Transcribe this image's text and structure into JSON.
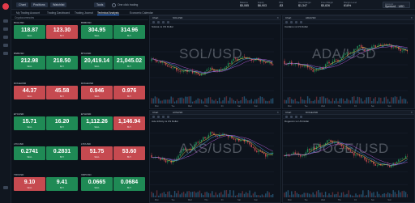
{
  "topbar": {
    "buttons": [
      "Chart",
      "Positions",
      "Watchlist",
      "Tools"
    ],
    "one_click_label": "One click trading",
    "account": [
      {
        "k": "Balance",
        "v": "$5,085"
      },
      {
        "k": "Equity",
        "v": "$6,903"
      },
      {
        "k": "P&L",
        "v": "-$3"
      },
      {
        "k": "Used Margin",
        "v": "$1,347"
      },
      {
        "k": "Free Margin",
        "v": "$5,826"
      },
      {
        "k": "Margin Level",
        "v": "818%"
      }
    ],
    "account_select": {
      "k": "Account",
      "v": "Sperion1 · USD"
    }
  },
  "tabs": [
    "My Trading Account",
    "Trading Dashboard",
    "Trading Journal",
    "Technical Analysis",
    "Economic Calendar"
  ],
  "market_watch": {
    "header": "Cryptocurrencies",
    "sell_label": "SELL",
    "buy_label": "BUY",
    "tiles": [
      {
        "name": "BCHUSD",
        "pct": "",
        "sell": "118.87",
        "buy": "123.30",
        "sc": "green",
        "bc": "red",
        "spread": ""
      },
      {
        "name": "BNBUSD",
        "pct": "",
        "sell": "304.95",
        "buy": "314.96",
        "sc": "green",
        "bc": "green",
        "spread": ""
      },
      {
        "name": "BNBUSD",
        "pct": "",
        "sell": "212.98",
        "buy": "218.50",
        "sc": "green",
        "bc": "green",
        "spread": ""
      },
      {
        "name": "BTCUSD",
        "pct": "",
        "sell": "20,419.14",
        "buy": "21,045.02",
        "sc": "green",
        "bc": "green",
        "spread": ""
      },
      {
        "name": "DOGEUSD",
        "pct": "",
        "sell": "44.37",
        "buy": "45.58",
        "sc": "red",
        "bc": "red",
        "spread": ""
      },
      {
        "name": "DOGEUSD",
        "pct": "",
        "sell": "0.946",
        "buy": "0.976",
        "sc": "red",
        "bc": "red",
        "spread": ""
      },
      {
        "name": "ETCUSD",
        "pct": "",
        "sell": "15.71",
        "buy": "16.20",
        "sc": "green",
        "bc": "green",
        "spread": ""
      },
      {
        "name": "ETHUSD",
        "pct": "",
        "sell": "1,112.26",
        "buy": "1,146.94",
        "sc": "green",
        "bc": "red",
        "spread": ""
      },
      {
        "name": "LTCUSD",
        "pct": "",
        "sell": "0.2741",
        "buy": "0.2831",
        "sc": "green",
        "bc": "green",
        "spread": ""
      },
      {
        "name": "LTCUSD",
        "pct": "",
        "sell": "51.75",
        "buy": "53.60",
        "sc": "red",
        "bc": "red",
        "spread": ""
      },
      {
        "name": "TRXUSD",
        "pct": "",
        "sell": "9.10",
        "buy": "9.41",
        "sc": "red",
        "bc": "green",
        "spread": ""
      },
      {
        "name": "XRPUSD",
        "pct": "",
        "sell": "0.0665",
        "buy": "0.0684",
        "sc": "green",
        "bc": "green",
        "spread": ""
      }
    ]
  },
  "charts": [
    {
      "symbol": "SOLUSD",
      "desc": "Solana vs US Dollar",
      "watermark": "SOL/USD",
      "chart_label": "Chart"
    },
    {
      "symbol": "ADAUSD",
      "desc": "Cardano vs US Dollar",
      "watermark": "ADA/USD",
      "chart_label": "Chart"
    },
    {
      "symbol": "AXSUSD",
      "desc": "Axie Infinity vs US Dollar",
      "watermark": "AXS/USD",
      "chart_label": "Chart"
    },
    {
      "symbol": "DOGEUSD",
      "desc": "Dogecoin vs US Dollar",
      "watermark": "DOGE/USD",
      "chart_label": "Chart"
    }
  ],
  "x_ticks": [
    "Mon",
    "Tue",
    "Wed",
    "Thu",
    "Fri",
    "Sat",
    "Sun"
  ],
  "colors": {
    "bull": "#1f8a55",
    "bear": "#c64a50",
    "accent": "#3f8cff",
    "brand": "#e23b4a"
  }
}
